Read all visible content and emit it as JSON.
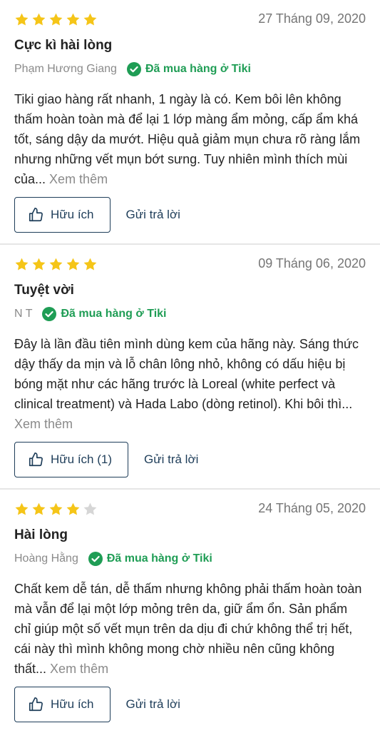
{
  "verified_label": "Đã mua hàng ở Tiki",
  "more_label": "Xem thêm",
  "reply_label": "Gửi trả lời",
  "colors": {
    "star_filled": "#f5c518",
    "star_empty": "#d6d6d6",
    "verified": "#1f9d55",
    "button": "#1e3d59"
  },
  "reviews": [
    {
      "rating": 5,
      "date": "27 Tháng 09, 2020",
      "title": "Cực kì hài lòng",
      "author": "Phạm Hương Giang",
      "body": "Tiki giao hàng rất nhanh, 1 ngày là có. Kem bôi lên không thấm hoàn toàn mà để lại 1 lớp màng ẩm mỏng, cấp ẩm khá tốt, sáng dậy da mướt. Hiệu quả giảm mụn chưa rõ ràng lắm nhưng những vết mụn bớt sưng. Tuy nhiên mình thích mùi của...",
      "helpful_label": "Hữu ích"
    },
    {
      "rating": 5,
      "date": "09 Tháng 06, 2020",
      "title": "Tuyệt vời",
      "author": "N T",
      "body": "Đây là lần đầu tiên mình dùng kem của hãng này. Sáng thức dậy thấy da mịn và lỗ chân lông nhỏ, không có dấu hiệu bị bóng mặt như các hãng trước là Loreal (white perfect và clinical treatment) và Hada Labo (dòng retinol). Khi bôi thì...",
      "helpful_label": "Hữu ích (1)"
    },
    {
      "rating": 4,
      "date": "24 Tháng 05, 2020",
      "title": "Hài lòng",
      "author": "Hoàng Hằng",
      "body": "Chất kem dễ tán, dễ thấm nhưng không phải thấm hoàn toàn mà vẫn để lại một lớp mỏng trên da, giữ ẩm ổn. Sản phẩm chỉ giúp một số vết mụn trên da dịu đi chứ không thể trị hết, cái này thì mình không mong chờ nhiều nên cũng không thất...",
      "helpful_label": "Hữu ích"
    }
  ]
}
